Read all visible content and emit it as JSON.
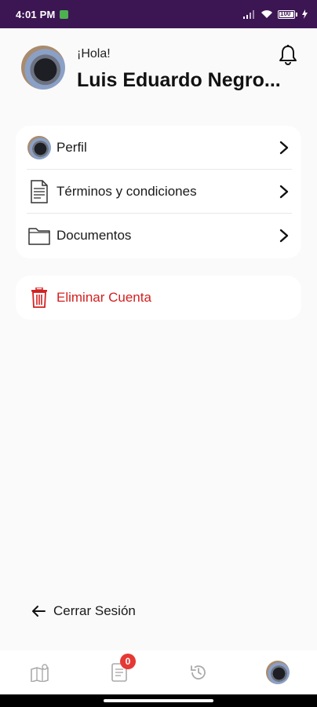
{
  "status_bar": {
    "time": "4:01 PM",
    "battery": "100"
  },
  "header": {
    "greeting": "¡Hola!",
    "user_name": "Luis Eduardo Negro..."
  },
  "menu": {
    "items": [
      {
        "label": "Perfil",
        "icon": "profile-avatar"
      },
      {
        "label": "Términos y condiciones",
        "icon": "document-text-icon"
      },
      {
        "label": "Documentos",
        "icon": "folder-icon"
      }
    ]
  },
  "danger": {
    "label": "Eliminar Cuenta",
    "icon": "trash-icon",
    "color": "#d32020"
  },
  "logout": {
    "label": "Cerrar Sesión",
    "icon": "arrow-left-icon"
  },
  "bottom_nav": {
    "items": [
      {
        "icon": "map-icon"
      },
      {
        "icon": "list-icon",
        "badge": "0"
      },
      {
        "icon": "history-icon"
      },
      {
        "icon": "profile-avatar"
      }
    ]
  },
  "colors": {
    "status_bar": "#3c1553",
    "danger": "#d32020",
    "badge": "#e53935"
  }
}
